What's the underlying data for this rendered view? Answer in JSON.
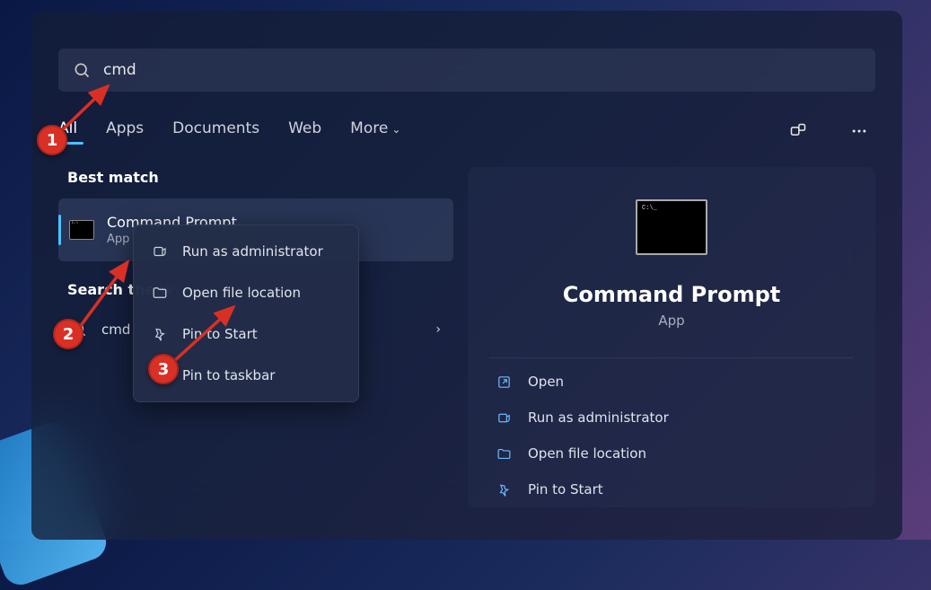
{
  "search": {
    "value": "cmd"
  },
  "tabs": [
    "All",
    "Apps",
    "Documents",
    "Web",
    "More"
  ],
  "section_best": "Best match",
  "result": {
    "title": "Command Prompt",
    "sub": "App"
  },
  "section_web": "Search the w",
  "web_row": {
    "text": "cmd"
  },
  "context_menu": [
    "Run as administrator",
    "Open file location",
    "Pin to Start",
    "Pin to taskbar"
  ],
  "preview": {
    "title": "Command Prompt",
    "sub": "App"
  },
  "actions": [
    "Open",
    "Run as administrator",
    "Open file location",
    "Pin to Start"
  ],
  "badges": {
    "b1": "1",
    "b2": "2",
    "b3": "3"
  }
}
